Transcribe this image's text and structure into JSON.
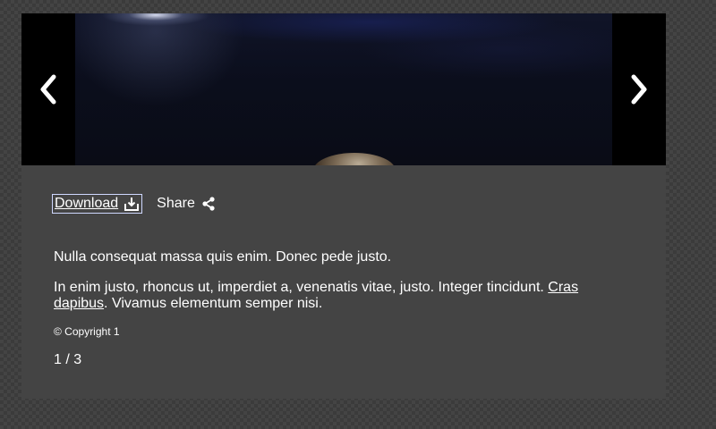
{
  "lightbox": {
    "media": {
      "prev_icon": "chevron-left-icon",
      "next_icon": "chevron-right-icon"
    },
    "actions": {
      "download_label": "Download",
      "download_icon": "download-icon",
      "share_label": "Share",
      "share_icon": "share-icon"
    },
    "caption": {
      "paragraph1": "Nulla consequat massa quis enim. Donec pede justo.",
      "paragraph2_before": "In enim justo, rhoncus ut, imperdiet a, venenatis vitae, justo. Integer tincidunt. ",
      "paragraph2_link": "Cras dapibus",
      "paragraph2_after": ". Vivamus elementum semper nisi."
    },
    "copyright": "© Copyright 1",
    "counter": "1 / 3"
  },
  "colors": {
    "panel": "#444444",
    "nav_background": "#000000",
    "text": "#ffffff"
  }
}
